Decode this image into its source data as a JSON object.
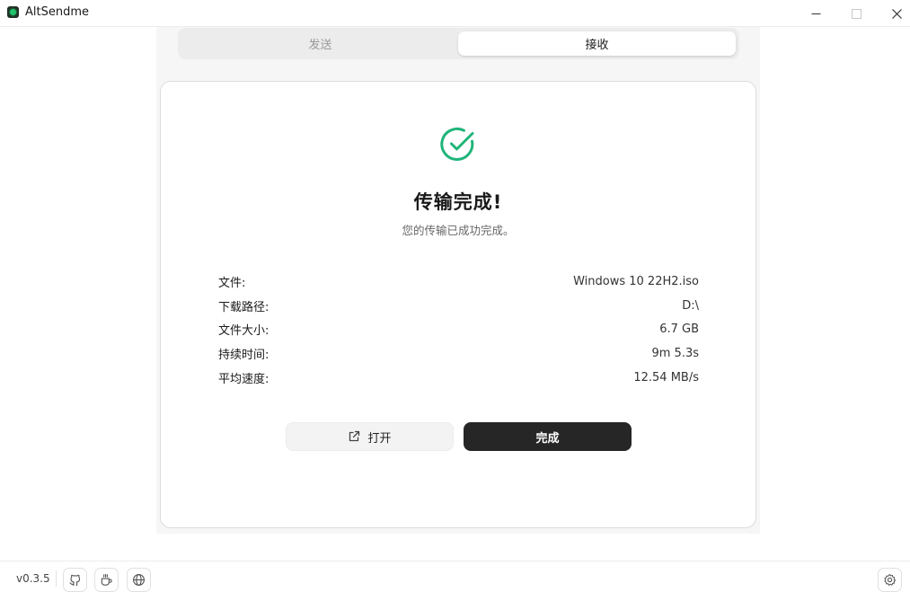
{
  "window": {
    "title": "AltSendme"
  },
  "tabs": [
    {
      "label": "发送",
      "active": false
    },
    {
      "label": "接收",
      "active": true
    }
  ],
  "result": {
    "title": "传输完成!",
    "subtitle": "您的传输已成功完成。",
    "icon": "check-circle-icon",
    "accent_color": "#1fb57a"
  },
  "details": [
    {
      "label": "文件:",
      "value": "Windows 10 22H2.iso"
    },
    {
      "label": "下载路径:",
      "value": "D:\\"
    },
    {
      "label": "文件大小:",
      "value": "6.7 GB"
    },
    {
      "label": "持续时间:",
      "value": "9m 5.3s"
    },
    {
      "label": "平均速度:",
      "value": "12.54 MB/s"
    }
  ],
  "actions": {
    "open_label": "打开",
    "done_label": "完成"
  },
  "footer": {
    "version": "v0.3.5",
    "icons": [
      "github-icon",
      "coffee-icon",
      "globe-icon",
      "settings-icon"
    ]
  }
}
